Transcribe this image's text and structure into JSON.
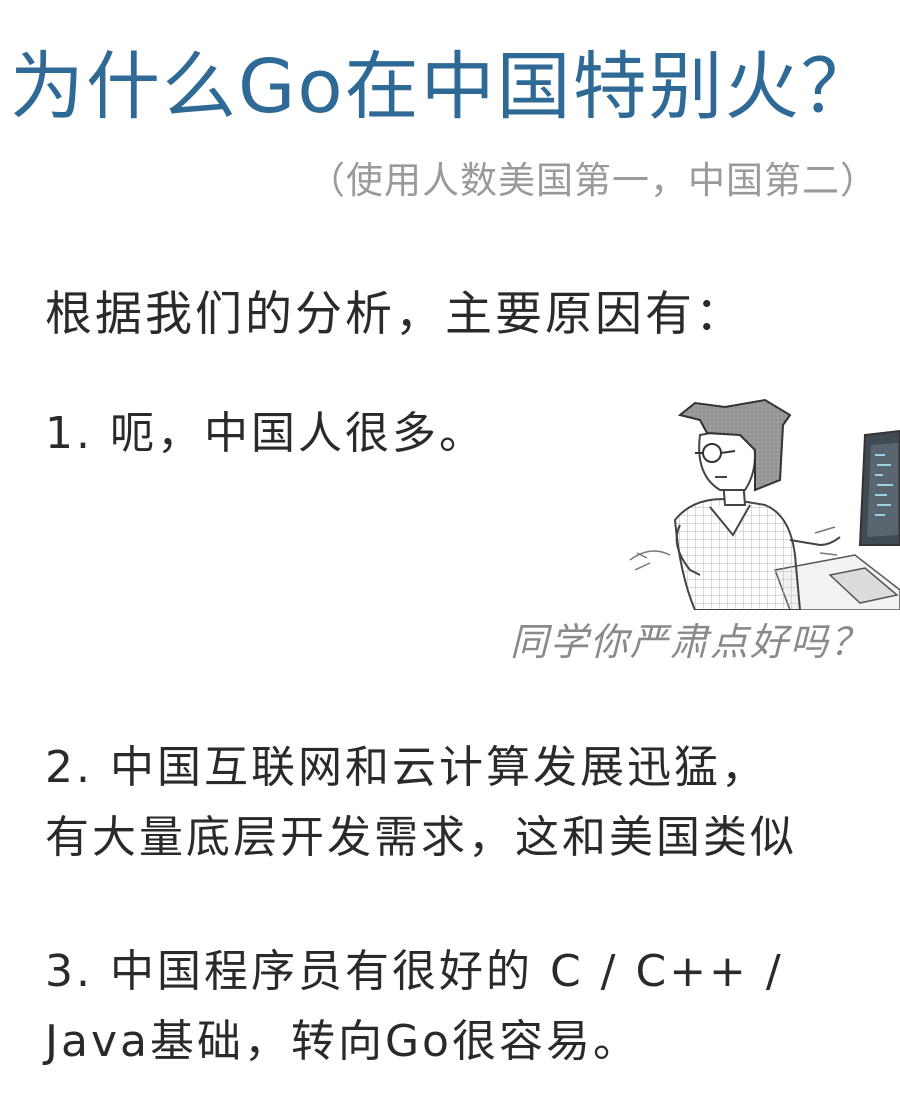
{
  "title": "为什么Go在中国特别火？",
  "subtitle": "（使用人数美国第一，中国第二）",
  "intro": "根据我们的分析，主要原因有：",
  "points": [
    {
      "lines": [
        "1. 呃，中国人很多。"
      ]
    },
    {
      "lines": [
        "2. 中国互联网和云计算发展迅猛，",
        "有大量底层开发需求，这和美国类似"
      ]
    },
    {
      "lines": [
        "3. 中国程序员有很好的 C / C++ /",
        "Java基础，转向Go很容易。"
      ]
    }
  ],
  "illustration": {
    "caption": "同学你严肃点好吗？",
    "icon": "programmer-at-computer-illustration"
  }
}
